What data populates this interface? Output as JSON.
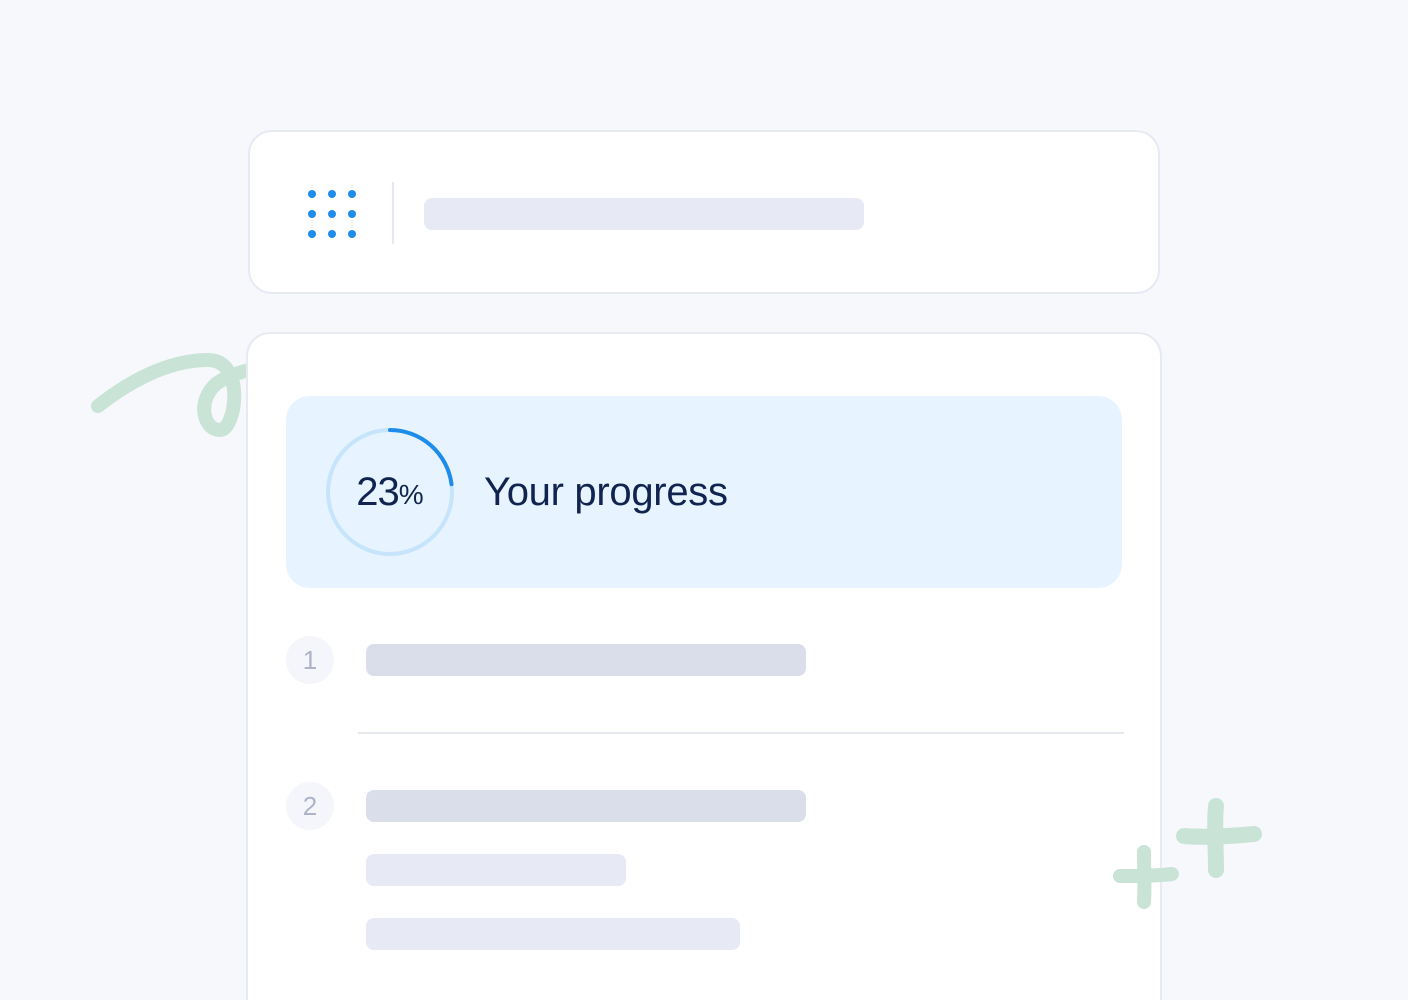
{
  "header": {
    "menu_icon": "app-grid-icon",
    "accent_color": "#1e8cea"
  },
  "progress": {
    "value": "23",
    "unit": "%",
    "fraction": 0.23,
    "title": "Your progress",
    "ring_color": "#1e8cea",
    "track_color": "#c6e4fb",
    "panel_color": "#e7f3fe"
  },
  "steps": [
    {
      "number": "1"
    },
    {
      "number": "2"
    }
  ],
  "decorations": {
    "color": "#c9e4d6",
    "squiggle": "squiggle-doodle",
    "sparkles": "sparkle-plus-icons"
  }
}
